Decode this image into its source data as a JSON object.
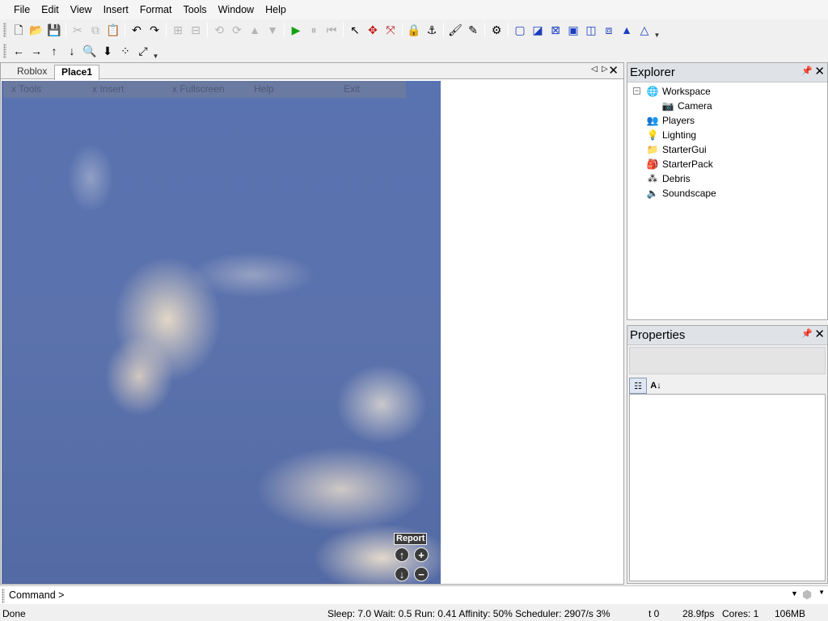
{
  "menu": [
    "File",
    "Edit",
    "View",
    "Insert",
    "Format",
    "Tools",
    "Window",
    "Help"
  ],
  "toolbar1_icons": [
    "new-file-icon",
    "open-folder-icon",
    "save-icon",
    "sep",
    "cut-icon",
    "copy-icon",
    "paste-icon",
    "sep",
    "undo-icon",
    "redo-icon",
    "sep",
    "group-icon",
    "ungroup-icon",
    "sep",
    "rotate-icon",
    "tilt-icon",
    "move-up-icon",
    "move-down-icon",
    "sep",
    "play-icon",
    "pause-icon",
    "reset-icon",
    "sep",
    "select-icon",
    "move-icon",
    "resize-icon",
    "sep",
    "lock-icon",
    "anchor-icon",
    "sep",
    "paint-icon",
    "dropper-icon",
    "sep",
    "weld-icon",
    "sep",
    "surface-icon",
    "surface-glue-icon",
    "surface-weld-icon",
    "surface-studs-icon",
    "surface-inlet-icon",
    "surface-universal-icon",
    "surface-hinge-icon",
    "surface-motor-icon"
  ],
  "toolbar2_icons": [
    "pan-left-icon",
    "pan-right-icon",
    "pan-up-icon",
    "pan-down-icon",
    "zoom-to-icon",
    "camera-down-icon",
    "zoom-extents-icon",
    "fullscreen-icon"
  ],
  "tabs": [
    "Roblox",
    "Place1"
  ],
  "tab_close": "✕",
  "game_menu": [
    "x Tools",
    "x Insert",
    "x Fullscreen",
    "Help",
    "Exit"
  ],
  "viewport": {
    "report": "Report"
  },
  "explorer": {
    "title": "Explorer",
    "items": [
      {
        "label": "Workspace",
        "icon": "globe-icon",
        "level": 0,
        "expanded": true
      },
      {
        "label": "Camera",
        "icon": "camera-icon",
        "level": 1
      },
      {
        "label": "Players",
        "icon": "players-icon",
        "level": 0
      },
      {
        "label": "Lighting",
        "icon": "lightbulb-icon",
        "level": 0
      },
      {
        "label": "StarterGui",
        "icon": "folder-icon",
        "level": 0
      },
      {
        "label": "StarterPack",
        "icon": "backpack-icon",
        "level": 0
      },
      {
        "label": "Debris",
        "icon": "debris-icon",
        "level": 0
      },
      {
        "label": "Soundscape",
        "icon": "speaker-icon",
        "level": 0
      }
    ]
  },
  "properties": {
    "title": "Properties"
  },
  "command": {
    "label": "Command >",
    "value": ""
  },
  "status": {
    "state": "Done",
    "perf": "Sleep: 7.0 Wait: 0.5 Run: 0.41 Affinity: 50% Scheduler: 2907/s 3%",
    "t": "t 0",
    "fps": "28.9fps",
    "cores": "Cores: 1",
    "mem": "106MB"
  },
  "colors": {
    "panel_header": "#dfe3e8",
    "sky": "#5973b0",
    "play_green": "#12a012",
    "select_blue": "#1a3fbf"
  }
}
